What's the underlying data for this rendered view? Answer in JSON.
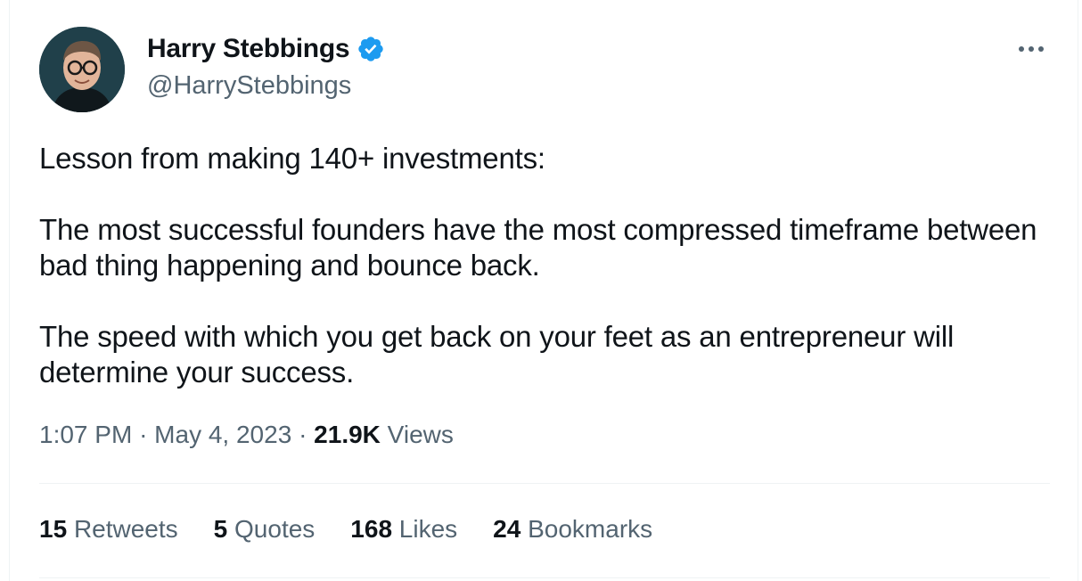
{
  "author": {
    "name": "Harry Stebbings",
    "handle": "@HarryStebbings",
    "verified_color": "#1d9bf0"
  },
  "tweet": {
    "paragraphs": [
      "Lesson from making 140+ investments:",
      "The most successful founders have the most compressed timeframe between bad thing happening and bounce back.",
      "The speed with which you get back on your feet as an entrepreneur will determine your success."
    ]
  },
  "meta": {
    "time": "1:07 PM",
    "separator": "·",
    "date": "May 4, 2023",
    "views_count": "21.9K",
    "views_label": "Views"
  },
  "stats": {
    "retweets": {
      "count": "15",
      "label": "Retweets"
    },
    "quotes": {
      "count": "5",
      "label": "Quotes"
    },
    "likes": {
      "count": "168",
      "label": "Likes"
    },
    "bookmarks": {
      "count": "24",
      "label": "Bookmarks"
    }
  },
  "icons": {
    "more": "more-horizontal-icon",
    "verified": "verified-badge-icon"
  }
}
